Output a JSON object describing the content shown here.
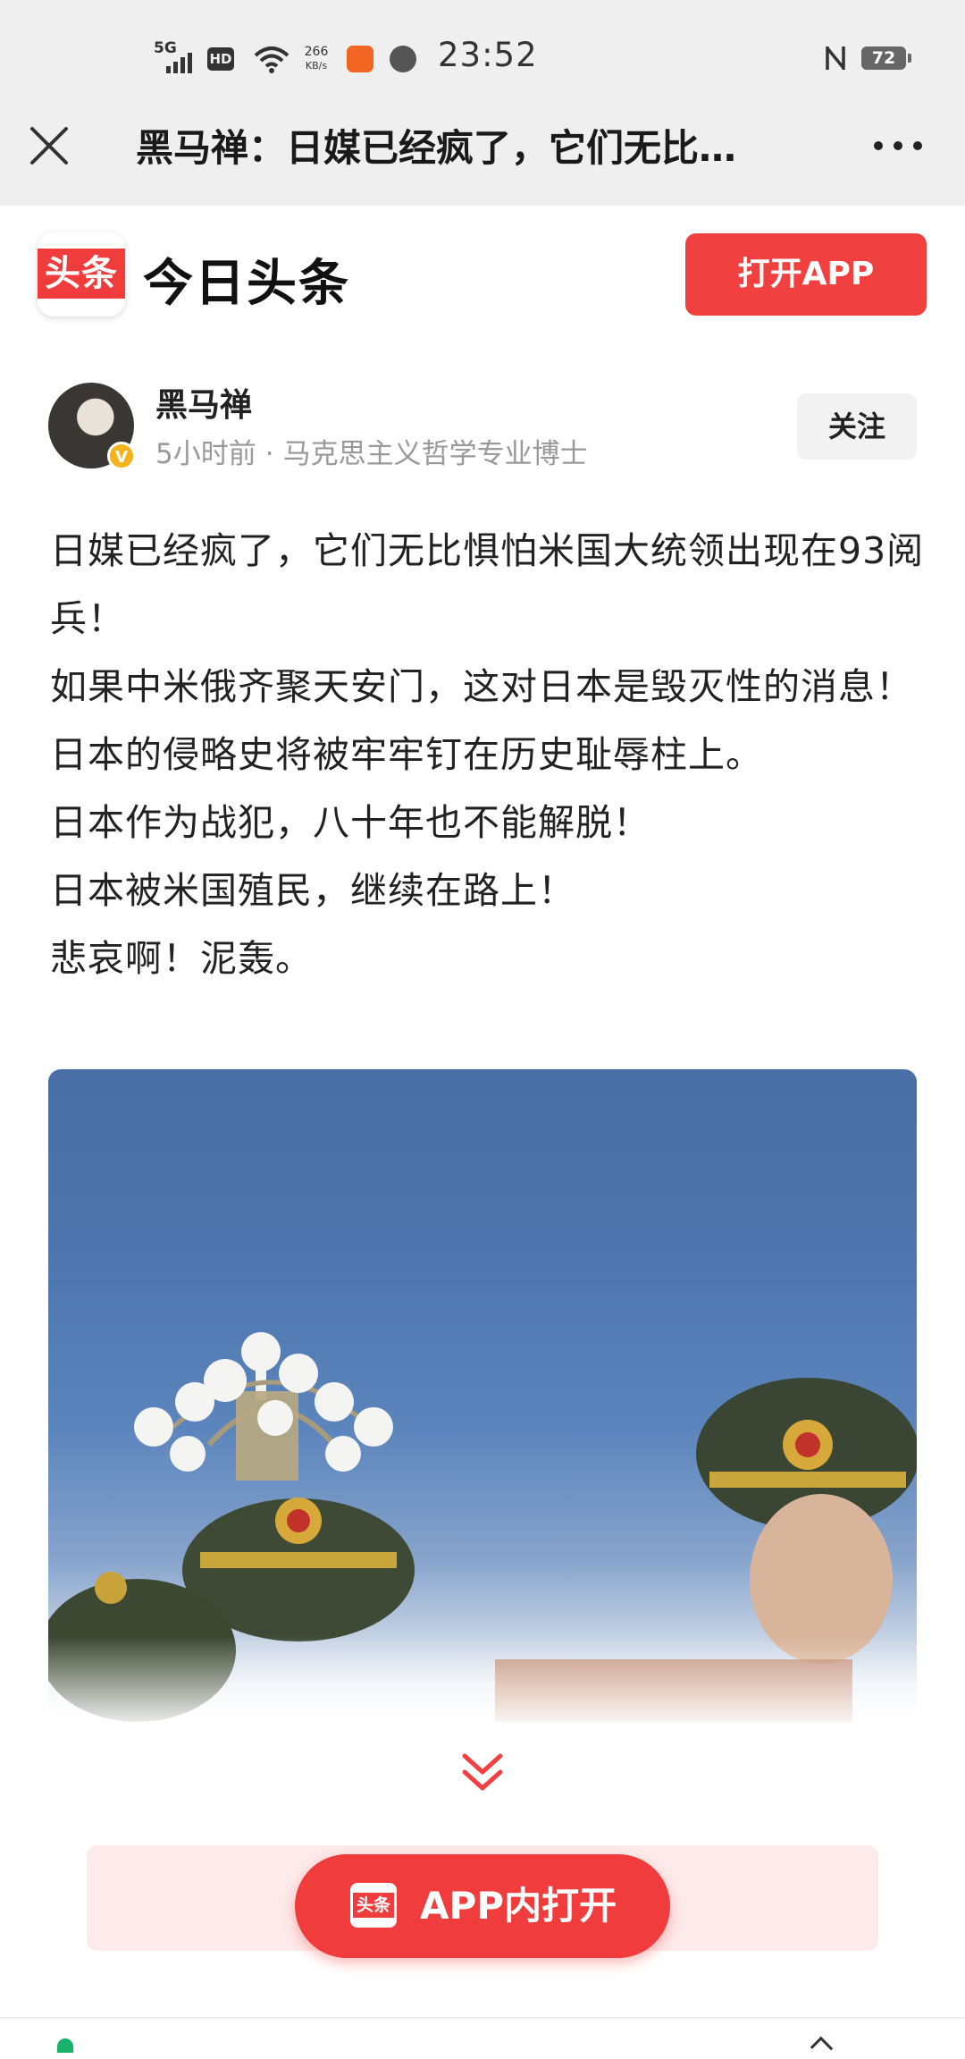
{
  "status_bar": {
    "network": "5G",
    "hd": "HD",
    "speed_value": "266",
    "speed_unit": "KB/s",
    "time": "23:52",
    "battery": "72"
  },
  "title_bar": {
    "title": "黑马禅：日媒已经疯了，它们无比…",
    "close_icon": "close-icon",
    "more_icon": "more-icon"
  },
  "app_header": {
    "logo_text": "头条",
    "app_name": "今日头条",
    "open_app_label": "打开APP"
  },
  "author": {
    "name": "黑马禅",
    "verified_badge": "V",
    "time": "5小时前",
    "separator": "·",
    "description": "马克思主义哲学专业博士",
    "follow_label": "关注"
  },
  "article": {
    "paragraphs": [
      "日媒已经疯了，它们无比惧怕米国大统领出现在93阅兵！",
      "如果中米俄齐聚天安门，这对日本是毁灭性的消息！",
      "日本的侵略史将被牢牢钉在历史耻辱柱上。",
      "日本作为战犯，八十年也不能解脱！",
      "日本被米国殖民，继续在路上！",
      "悲哀啊！泥轰。"
    ]
  },
  "image": {
    "alt_icon": "photo-image",
    "colors": {
      "sky": "#4f76ae",
      "fade": "#ffffff"
    }
  },
  "expand": {
    "icon": "double-chevron-down-icon"
  },
  "bottom_cta": {
    "logo_text": "头条",
    "label": "APP内打开"
  },
  "colors": {
    "brand_red": "#f03c3c",
    "banner_bg": "#fdeaea",
    "status_bg": "#efeff0"
  }
}
